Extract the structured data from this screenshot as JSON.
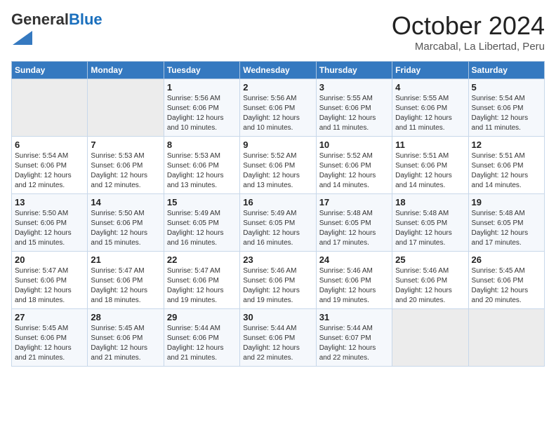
{
  "header": {
    "logo_general": "General",
    "logo_blue": "Blue",
    "month_title": "October 2024",
    "location": "Marcabal, La Libertad, Peru"
  },
  "days_of_week": [
    "Sunday",
    "Monday",
    "Tuesday",
    "Wednesday",
    "Thursday",
    "Friday",
    "Saturday"
  ],
  "weeks": [
    [
      {
        "day": "",
        "detail": ""
      },
      {
        "day": "",
        "detail": ""
      },
      {
        "day": "1",
        "detail": "Sunrise: 5:56 AM\nSunset: 6:06 PM\nDaylight: 12 hours and 10 minutes."
      },
      {
        "day": "2",
        "detail": "Sunrise: 5:56 AM\nSunset: 6:06 PM\nDaylight: 12 hours and 10 minutes."
      },
      {
        "day": "3",
        "detail": "Sunrise: 5:55 AM\nSunset: 6:06 PM\nDaylight: 12 hours and 11 minutes."
      },
      {
        "day": "4",
        "detail": "Sunrise: 5:55 AM\nSunset: 6:06 PM\nDaylight: 12 hours and 11 minutes."
      },
      {
        "day": "5",
        "detail": "Sunrise: 5:54 AM\nSunset: 6:06 PM\nDaylight: 12 hours and 11 minutes."
      }
    ],
    [
      {
        "day": "6",
        "detail": "Sunrise: 5:54 AM\nSunset: 6:06 PM\nDaylight: 12 hours and 12 minutes."
      },
      {
        "day": "7",
        "detail": "Sunrise: 5:53 AM\nSunset: 6:06 PM\nDaylight: 12 hours and 12 minutes."
      },
      {
        "day": "8",
        "detail": "Sunrise: 5:53 AM\nSunset: 6:06 PM\nDaylight: 12 hours and 13 minutes."
      },
      {
        "day": "9",
        "detail": "Sunrise: 5:52 AM\nSunset: 6:06 PM\nDaylight: 12 hours and 13 minutes."
      },
      {
        "day": "10",
        "detail": "Sunrise: 5:52 AM\nSunset: 6:06 PM\nDaylight: 12 hours and 14 minutes."
      },
      {
        "day": "11",
        "detail": "Sunrise: 5:51 AM\nSunset: 6:06 PM\nDaylight: 12 hours and 14 minutes."
      },
      {
        "day": "12",
        "detail": "Sunrise: 5:51 AM\nSunset: 6:06 PM\nDaylight: 12 hours and 14 minutes."
      }
    ],
    [
      {
        "day": "13",
        "detail": "Sunrise: 5:50 AM\nSunset: 6:06 PM\nDaylight: 12 hours and 15 minutes."
      },
      {
        "day": "14",
        "detail": "Sunrise: 5:50 AM\nSunset: 6:06 PM\nDaylight: 12 hours and 15 minutes."
      },
      {
        "day": "15",
        "detail": "Sunrise: 5:49 AM\nSunset: 6:05 PM\nDaylight: 12 hours and 16 minutes."
      },
      {
        "day": "16",
        "detail": "Sunrise: 5:49 AM\nSunset: 6:05 PM\nDaylight: 12 hours and 16 minutes."
      },
      {
        "day": "17",
        "detail": "Sunrise: 5:48 AM\nSunset: 6:05 PM\nDaylight: 12 hours and 17 minutes."
      },
      {
        "day": "18",
        "detail": "Sunrise: 5:48 AM\nSunset: 6:05 PM\nDaylight: 12 hours and 17 minutes."
      },
      {
        "day": "19",
        "detail": "Sunrise: 5:48 AM\nSunset: 6:05 PM\nDaylight: 12 hours and 17 minutes."
      }
    ],
    [
      {
        "day": "20",
        "detail": "Sunrise: 5:47 AM\nSunset: 6:06 PM\nDaylight: 12 hours and 18 minutes."
      },
      {
        "day": "21",
        "detail": "Sunrise: 5:47 AM\nSunset: 6:06 PM\nDaylight: 12 hours and 18 minutes."
      },
      {
        "day": "22",
        "detail": "Sunrise: 5:47 AM\nSunset: 6:06 PM\nDaylight: 12 hours and 19 minutes."
      },
      {
        "day": "23",
        "detail": "Sunrise: 5:46 AM\nSunset: 6:06 PM\nDaylight: 12 hours and 19 minutes."
      },
      {
        "day": "24",
        "detail": "Sunrise: 5:46 AM\nSunset: 6:06 PM\nDaylight: 12 hours and 19 minutes."
      },
      {
        "day": "25",
        "detail": "Sunrise: 5:46 AM\nSunset: 6:06 PM\nDaylight: 12 hours and 20 minutes."
      },
      {
        "day": "26",
        "detail": "Sunrise: 5:45 AM\nSunset: 6:06 PM\nDaylight: 12 hours and 20 minutes."
      }
    ],
    [
      {
        "day": "27",
        "detail": "Sunrise: 5:45 AM\nSunset: 6:06 PM\nDaylight: 12 hours and 21 minutes."
      },
      {
        "day": "28",
        "detail": "Sunrise: 5:45 AM\nSunset: 6:06 PM\nDaylight: 12 hours and 21 minutes."
      },
      {
        "day": "29",
        "detail": "Sunrise: 5:44 AM\nSunset: 6:06 PM\nDaylight: 12 hours and 21 minutes."
      },
      {
        "day": "30",
        "detail": "Sunrise: 5:44 AM\nSunset: 6:06 PM\nDaylight: 12 hours and 22 minutes."
      },
      {
        "day": "31",
        "detail": "Sunrise: 5:44 AM\nSunset: 6:07 PM\nDaylight: 12 hours and 22 minutes."
      },
      {
        "day": "",
        "detail": ""
      },
      {
        "day": "",
        "detail": ""
      }
    ]
  ]
}
